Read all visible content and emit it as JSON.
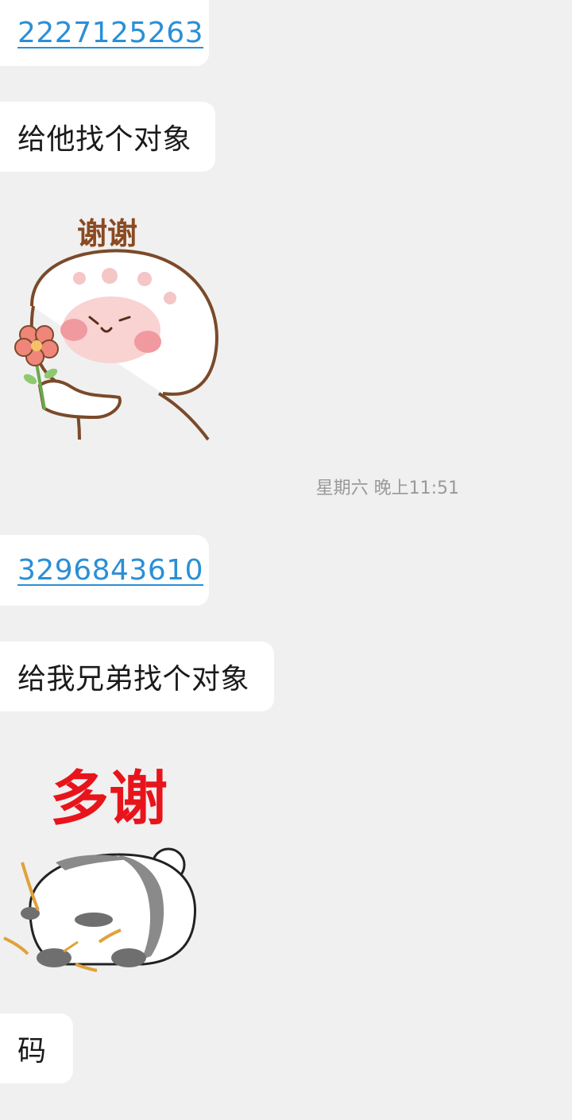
{
  "messages": [
    {
      "type": "text",
      "link": true,
      "text": "2227125263"
    },
    {
      "type": "text",
      "link": false,
      "text": "给他找个对象"
    },
    {
      "type": "sticker",
      "icon": "thank-you-sticker",
      "caption": "谢谢"
    },
    {
      "type": "timestamp",
      "text": "星期六 晚上11:51"
    },
    {
      "type": "text",
      "link": true,
      "text": "3296843610"
    },
    {
      "type": "text",
      "link": false,
      "text": "给我兄弟找个对象"
    },
    {
      "type": "sticker",
      "icon": "panda-thanks-sticker",
      "caption": "多谢"
    },
    {
      "type": "text",
      "link": false,
      "text": "码"
    }
  ],
  "colors": {
    "background": "#f0f0f0",
    "bubble": "#ffffff",
    "link": "#2b8fd6",
    "timestamp": "#999999",
    "sticker_caption_brown": "#8a4a22",
    "sticker_caption_red": "#e8141c"
  }
}
